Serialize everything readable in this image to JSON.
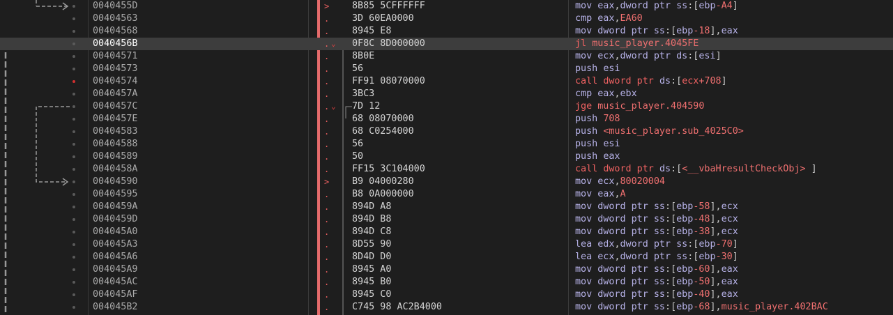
{
  "rows": [
    {
      "addr": "0040455D",
      "mark": ">",
      "bytes": "8B85 5CFFFFFF",
      "mn": "mov",
      "ops": [
        [
          "reg",
          "eax"
        ],
        [
          "t",
          ","
        ],
        [
          "reg",
          "dword ptr "
        ],
        [
          "seg",
          "ss"
        ],
        [
          "t",
          ":["
        ],
        [
          "reg",
          "ebp"
        ],
        [
          "num",
          "-A4"
        ],
        [
          "t",
          "]"
        ]
      ],
      "kind": "normal"
    },
    {
      "addr": "00404563",
      "mark": ".",
      "bytes": "3D 60EA0000",
      "mn": "cmp",
      "ops": [
        [
          "reg",
          "eax"
        ],
        [
          "t",
          ","
        ],
        [
          "num",
          "EA60"
        ]
      ],
      "kind": "normal"
    },
    {
      "addr": "00404568",
      "mark": ".",
      "bytes": "8945 E8",
      "mn": "mov",
      "ops": [
        [
          "reg",
          "dword ptr "
        ],
        [
          "seg",
          "ss"
        ],
        [
          "t",
          ":["
        ],
        [
          "reg",
          "ebp"
        ],
        [
          "num",
          "-18"
        ],
        [
          "t",
          "],"
        ],
        [
          "reg",
          "eax"
        ]
      ],
      "kind": "normal"
    },
    {
      "addr": "0040456B",
      "mark": ".",
      "bytes": "0F8C 8D000000",
      "mn": "jl",
      "ops": [
        [
          "num",
          "music_player.4045FE"
        ]
      ],
      "kind": "jump",
      "selected": true
    },
    {
      "addr": "00404571",
      "mark": ".",
      "bytes": "8B0E",
      "mn": "mov",
      "ops": [
        [
          "reg",
          "ecx"
        ],
        [
          "t",
          ","
        ],
        [
          "reg",
          "dword ptr "
        ],
        [
          "seg",
          "ds"
        ],
        [
          "t",
          ":["
        ],
        [
          "reg",
          "esi"
        ],
        [
          "t",
          "]"
        ]
      ],
      "kind": "normal"
    },
    {
      "addr": "00404573",
      "mark": ".",
      "bytes": "56",
      "mn": "push",
      "ops": [
        [
          "reg",
          "esi"
        ]
      ],
      "kind": "normal"
    },
    {
      "addr": "00404574",
      "mark": ".",
      "bytes": "FF91 08070000",
      "mn": "call",
      "ops": [
        [
          "reg",
          "dword ptr "
        ],
        [
          "seg",
          "ds"
        ],
        [
          "t",
          ":["
        ],
        [
          "reg",
          "ecx"
        ],
        [
          "num",
          "+708"
        ],
        [
          "t",
          "]"
        ]
      ],
      "kind": "call",
      "bp": true
    },
    {
      "addr": "0040457A",
      "mark": ".",
      "bytes": "3BC3",
      "mn": "cmp",
      "ops": [
        [
          "reg",
          "eax"
        ],
        [
          "t",
          ","
        ],
        [
          "reg",
          "ebx"
        ]
      ],
      "kind": "normal"
    },
    {
      "addr": "0040457C",
      "mark": ".",
      "bytes": "7D 12",
      "mn": "jge",
      "ops": [
        [
          "num",
          "music_player.404590"
        ]
      ],
      "kind": "jump"
    },
    {
      "addr": "0040457E",
      "mark": ".",
      "bytes": "68 08070000",
      "mn": "push",
      "ops": [
        [
          "num",
          "708"
        ]
      ],
      "kind": "normal"
    },
    {
      "addr": "00404583",
      "mark": ".",
      "bytes": "68 C0254000",
      "mn": "push",
      "ops": [
        [
          "num",
          "<music_player.sub_4025C0>"
        ]
      ],
      "kind": "normal"
    },
    {
      "addr": "00404588",
      "mark": ".",
      "bytes": "56",
      "mn": "push",
      "ops": [
        [
          "reg",
          "esi"
        ]
      ],
      "kind": "normal"
    },
    {
      "addr": "00404589",
      "mark": ".",
      "bytes": "50",
      "mn": "push",
      "ops": [
        [
          "reg",
          "eax"
        ]
      ],
      "kind": "normal"
    },
    {
      "addr": "0040458A",
      "mark": ".",
      "bytes": "FF15 3C104000",
      "mn": "call",
      "ops": [
        [
          "reg",
          "dword ptr "
        ],
        [
          "seg",
          "ds"
        ],
        [
          "t",
          ":["
        ],
        [
          "num",
          "<__vbaHresultCheckObj>"
        ],
        [
          "t",
          " ]"
        ]
      ],
      "kind": "call"
    },
    {
      "addr": "00404590",
      "mark": ">",
      "bytes": "B9 04000280",
      "mn": "mov",
      "ops": [
        [
          "reg",
          "ecx"
        ],
        [
          "t",
          ","
        ],
        [
          "num",
          "80020004"
        ]
      ],
      "kind": "normal"
    },
    {
      "addr": "00404595",
      "mark": ".",
      "bytes": "B8 0A000000",
      "mn": "mov",
      "ops": [
        [
          "reg",
          "eax"
        ],
        [
          "t",
          ","
        ],
        [
          "num",
          "A"
        ]
      ],
      "kind": "normal"
    },
    {
      "addr": "0040459A",
      "mark": ".",
      "bytes": "894D A8",
      "mn": "mov",
      "ops": [
        [
          "reg",
          "dword ptr "
        ],
        [
          "seg",
          "ss"
        ],
        [
          "t",
          ":["
        ],
        [
          "reg",
          "ebp"
        ],
        [
          "num",
          "-58"
        ],
        [
          "t",
          "],"
        ],
        [
          "reg",
          "ecx"
        ]
      ],
      "kind": "normal"
    },
    {
      "addr": "0040459D",
      "mark": ".",
      "bytes": "894D B8",
      "mn": "mov",
      "ops": [
        [
          "reg",
          "dword ptr "
        ],
        [
          "seg",
          "ss"
        ],
        [
          "t",
          ":["
        ],
        [
          "reg",
          "ebp"
        ],
        [
          "num",
          "-48"
        ],
        [
          "t",
          "],"
        ],
        [
          "reg",
          "ecx"
        ]
      ],
      "kind": "normal"
    },
    {
      "addr": "004045A0",
      "mark": ".",
      "bytes": "894D C8",
      "mn": "mov",
      "ops": [
        [
          "reg",
          "dword ptr "
        ],
        [
          "seg",
          "ss"
        ],
        [
          "t",
          ":["
        ],
        [
          "reg",
          "ebp"
        ],
        [
          "num",
          "-38"
        ],
        [
          "t",
          "],"
        ],
        [
          "reg",
          "ecx"
        ]
      ],
      "kind": "normal"
    },
    {
      "addr": "004045A3",
      "mark": ".",
      "bytes": "8D55 90",
      "mn": "lea",
      "ops": [
        [
          "reg",
          "edx"
        ],
        [
          "t",
          ","
        ],
        [
          "reg",
          "dword ptr "
        ],
        [
          "seg",
          "ss"
        ],
        [
          "t",
          ":["
        ],
        [
          "reg",
          "ebp"
        ],
        [
          "num",
          "-70"
        ],
        [
          "t",
          "]"
        ]
      ],
      "kind": "normal"
    },
    {
      "addr": "004045A6",
      "mark": ".",
      "bytes": "8D4D D0",
      "mn": "lea",
      "ops": [
        [
          "reg",
          "ecx"
        ],
        [
          "t",
          ","
        ],
        [
          "reg",
          "dword ptr "
        ],
        [
          "seg",
          "ss"
        ],
        [
          "t",
          ":["
        ],
        [
          "reg",
          "ebp"
        ],
        [
          "num",
          "-30"
        ],
        [
          "t",
          "]"
        ]
      ],
      "kind": "normal"
    },
    {
      "addr": "004045A9",
      "mark": ".",
      "bytes": "8945 A0",
      "mn": "mov",
      "ops": [
        [
          "reg",
          "dword ptr "
        ],
        [
          "seg",
          "ss"
        ],
        [
          "t",
          ":["
        ],
        [
          "reg",
          "ebp"
        ],
        [
          "num",
          "-60"
        ],
        [
          "t",
          "],"
        ],
        [
          "reg",
          "eax"
        ]
      ],
      "kind": "normal"
    },
    {
      "addr": "004045AC",
      "mark": ".",
      "bytes": "8945 B0",
      "mn": "mov",
      "ops": [
        [
          "reg",
          "dword ptr "
        ],
        [
          "seg",
          "ss"
        ],
        [
          "t",
          ":["
        ],
        [
          "reg",
          "ebp"
        ],
        [
          "num",
          "-50"
        ],
        [
          "t",
          "],"
        ],
        [
          "reg",
          "eax"
        ]
      ],
      "kind": "normal"
    },
    {
      "addr": "004045AF",
      "mark": ".",
      "bytes": "8945 C0",
      "mn": "mov",
      "ops": [
        [
          "reg",
          "dword ptr "
        ],
        [
          "seg",
          "ss"
        ],
        [
          "t",
          ":["
        ],
        [
          "reg",
          "ebp"
        ],
        [
          "num",
          "-40"
        ],
        [
          "t",
          "],"
        ],
        [
          "reg",
          "eax"
        ]
      ],
      "kind": "normal"
    },
    {
      "addr": "004045B2",
      "mark": ".",
      "bytes": "C745 98 AC2B4000",
      "mn": "mov",
      "ops": [
        [
          "reg",
          "dword ptr "
        ],
        [
          "seg",
          "ss"
        ],
        [
          "t",
          ":["
        ],
        [
          "reg",
          "ebp"
        ],
        [
          "num",
          "-68"
        ],
        [
          "t",
          "],"
        ],
        [
          "num",
          "music_player.402BAC"
        ]
      ],
      "kind": "normal"
    }
  ],
  "colors": {
    "background": "#1e1e1e",
    "selected_row": "#3d3d3d",
    "address": "#a9a9a9",
    "bytes": "#d4d4d4",
    "mnemonic": "#b7b2e8",
    "call_jump": "#f06262",
    "number": "#f07070",
    "breakpoint_dot": "#d03030",
    "eip_bar": "#e56b6b",
    "jump_arrow": "#9a9a9a"
  }
}
